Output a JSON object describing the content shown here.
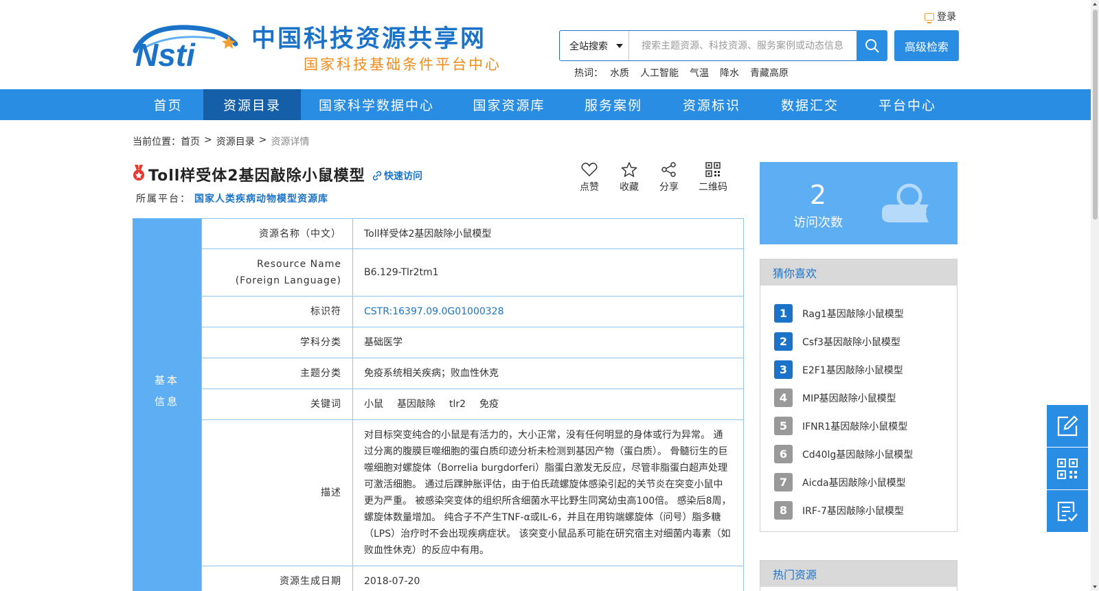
{
  "header": {
    "site_title": "中国科技资源共享网",
    "site_subtitle": "国家科技基础条件平台中心",
    "logo_text": "Nsti",
    "login_label": "登录",
    "search": {
      "scope": "全站搜索",
      "placeholder": "搜索主题资源、科技资源、服务案例或动态信息",
      "advanced_label": "高级检索"
    },
    "hotwords_label": "热词：",
    "hotwords": [
      "水质",
      "人工智能",
      "气温",
      "降水",
      "青藏高原"
    ]
  },
  "nav": {
    "items": [
      "首页",
      "资源目录",
      "国家科学数据中心",
      "国家资源库",
      "服务案例",
      "资源标识",
      "数据汇交",
      "平台中心"
    ],
    "active": "资源目录"
  },
  "breadcrumb": {
    "prefix": "当前位置：",
    "items": [
      "首页",
      ">",
      "资源目录",
      ">",
      "资源详情"
    ]
  },
  "resource": {
    "title": "Toll样受体2基因敲除小鼠模型",
    "quick_access": "快速访问",
    "platform_label": "所属平台：",
    "platform_value": "国家人类疾病动物模型资源库"
  },
  "actions": {
    "like": "点赞",
    "favorite": "收藏",
    "share": "分享",
    "qrcode": "二维码"
  },
  "info": {
    "section_label_line1": "基本",
    "section_label_line2": "信息",
    "rows": [
      {
        "key": "资源名称（中文）",
        "value": "Toll样受体2基因敲除小鼠模型"
      },
      {
        "key_line1": "Resource Name",
        "key_line2": "(Foreign Language)",
        "value": "B6.129-Tlr2tm1"
      },
      {
        "key": "标识符",
        "value": "CSTR:16397.09.0G01000328"
      },
      {
        "key": "学科分类",
        "value": "基础医学"
      },
      {
        "key": "主题分类",
        "value": "免疫系统相关疾病；败血性休克"
      },
      {
        "key": "关键词",
        "keywords": [
          "小鼠",
          "基因敲除",
          "tlr2",
          "免疫"
        ]
      },
      {
        "key": "描述",
        "value": "对目标突变纯合的小鼠是有活力的，大小正常，没有任何明显的身体或行为异常。 通过分离的腹膜巨噬细胞的蛋白质印迹分析未检测到基因产物（蛋白质）。 骨髓衍生的巨噬细胞对螺旋体（Borrelia burgdorferi）脂蛋白激发无反应，尽管非脂蛋白超声处理可激活细胞。 通过后踝肿胀评估，由于伯氏疏螺旋体感染引起的关节炎在突变小鼠中更为严重。 被感染突变体的组织所含细菌水平比野生同窝幼虫高100倍。 感染后8周，螺旋体数量增加。 纯合子不产生TNF-α或IL-6，并且在用钩端螺旋体（问号）脂多糖（LPS）治疗时不会出现疾病症状。 该突变小鼠品系可能在研究宿主对细菌内毒素（如败血性休克）的反应中有用。"
      },
      {
        "key": "资源生成日期",
        "value": "2018-07-20"
      }
    ]
  },
  "visits": {
    "count": "2",
    "label": "访问次数"
  },
  "guess": {
    "title": "猜你喜欢",
    "items": [
      {
        "rank": "1",
        "name": "Rag1基因敲除小鼠模型"
      },
      {
        "rank": "2",
        "name": "Csf3基因敲除小鼠模型"
      },
      {
        "rank": "3",
        "name": "E2F1基因敲除小鼠模型"
      },
      {
        "rank": "4",
        "name": "MIP基因敲除小鼠模型"
      },
      {
        "rank": "5",
        "name": "IFNR1基因敲除小鼠模型"
      },
      {
        "rank": "6",
        "name": "Cd40lg基因敲除小鼠模型"
      },
      {
        "rank": "7",
        "name": "Aicda基因敲除小鼠模型"
      },
      {
        "rank": "8",
        "name": "IRF-7基因敲除小鼠模型"
      }
    ]
  },
  "hot": {
    "title": "热门资源"
  },
  "colors": {
    "primary": "#2a8de4",
    "nav_active": "#155fa8",
    "link": "#1a73c9",
    "accent_orange": "#f08c1e",
    "side_blue": "#5eaef4"
  }
}
